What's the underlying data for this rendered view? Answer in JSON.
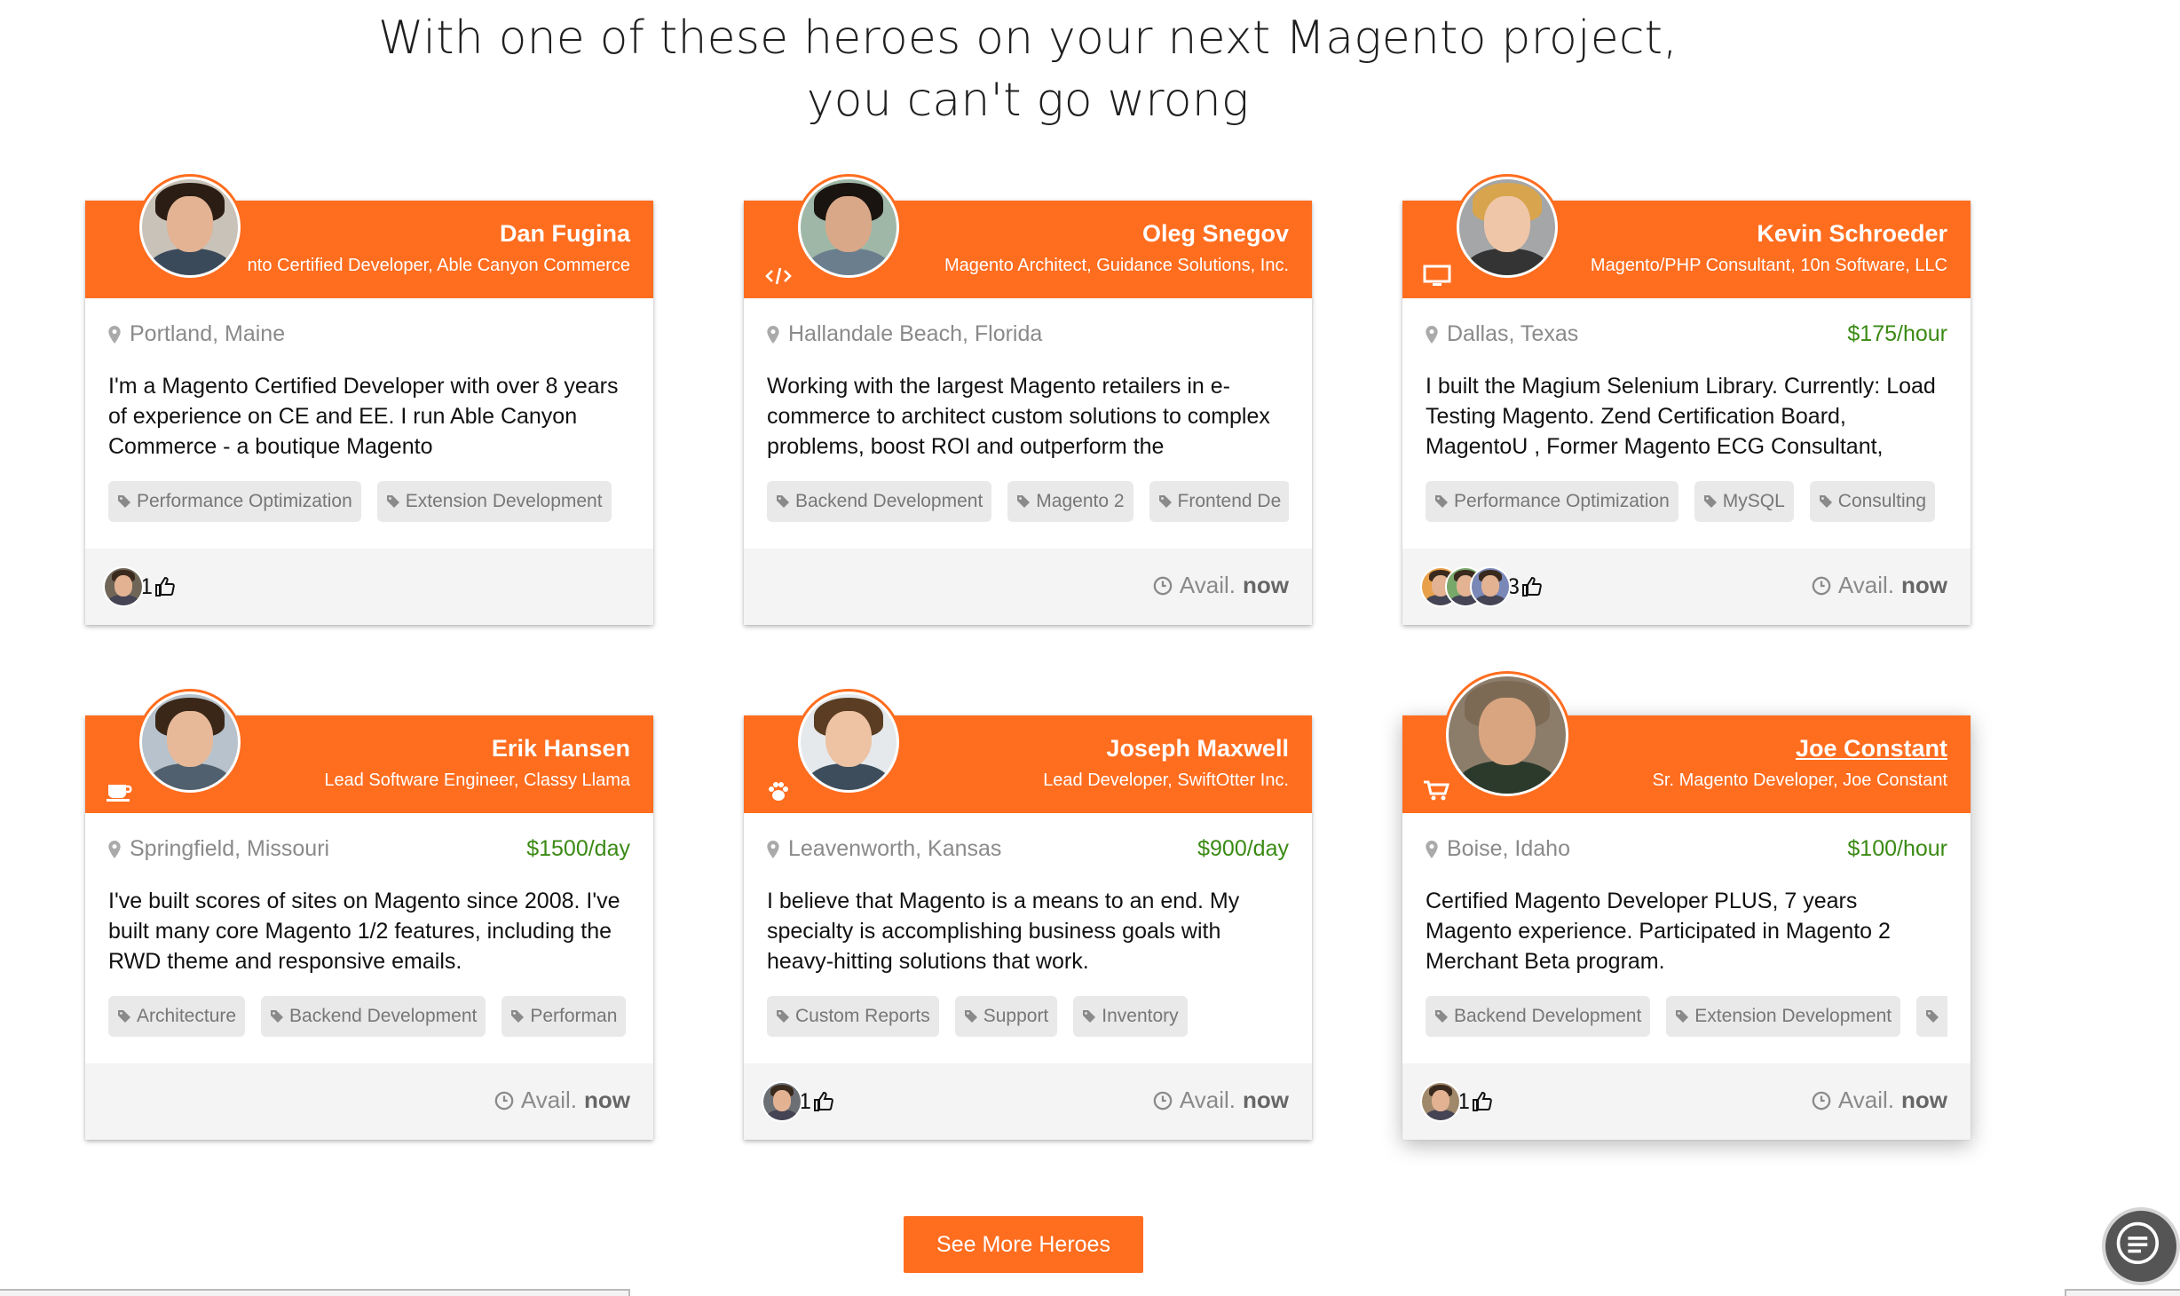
{
  "headline": {
    "line1": "With one of these heroes on your next Magento project,",
    "line2": "you can't go wrong"
  },
  "colors": {
    "accent": "#ff6d1f",
    "rate": "#3a8a14",
    "tag_bg": "#e9e9e9"
  },
  "heroes": [
    {
      "name": "Dan Fugina",
      "title": "nto Certified Developer, Able Canyon Commerce",
      "head_icon": "",
      "location": "Portland, Maine",
      "rate": "",
      "bio": "I'm a Magento Certified Developer with over 8 years of experience on CE and EE. I run Able Canyon Commerce - a boutique Magento",
      "tags": [
        "Performance Optimization",
        "Extension Development"
      ],
      "likes": "1",
      "voter_count": 1,
      "avail_label": "",
      "avail_value": ""
    },
    {
      "name": "Oleg Snegov",
      "title": "Magento Architect, Guidance Solutions, Inc.",
      "head_icon": "code-icon",
      "location": "Hallandale Beach, Florida",
      "rate": "",
      "bio": "Working with the largest Magento retailers in e-commerce to architect custom solutions to complex problems, boost ROI and outperform the",
      "tags": [
        "Backend Development",
        "Magento 2",
        "Frontend De"
      ],
      "likes": "",
      "voter_count": 0,
      "avail_label": "Avail.",
      "avail_value": "now"
    },
    {
      "name": "Kevin Schroeder",
      "title": "Magento/PHP Consultant, 10n Software, LLC",
      "head_icon": "desktop-icon",
      "location": "Dallas, Texas",
      "rate": "$175/hour",
      "bio": "I built the Magium Selenium Library. Currently: Load Testing Magento. Zend Certification Board, MagentoU , Former Magento ECG Consultant,",
      "tags": [
        "Performance Optimization",
        "MySQL",
        "Consulting"
      ],
      "likes": "3",
      "voter_count": 3,
      "avail_label": "Avail.",
      "avail_value": "now"
    },
    {
      "name": "Erik Hansen",
      "title": "Lead Software Engineer, Classy Llama",
      "head_icon": "coffee-icon",
      "location": "Springfield, Missouri",
      "rate": "$1500/day",
      "bio": "I've built scores of sites on Magento since 2008. I've built many core Magento 1/2 features, including the RWD theme and responsive emails.",
      "tags": [
        "Architecture",
        "Backend Development",
        "Performan"
      ],
      "likes": "",
      "voter_count": 0,
      "avail_label": "Avail.",
      "avail_value": "now"
    },
    {
      "name": "Joseph Maxwell",
      "title": "Lead Developer, SwiftOtter Inc.",
      "head_icon": "paw-icon",
      "location": "Leavenworth, Kansas",
      "rate": "$900/day",
      "bio": "I believe that Magento is a means to an end. My specialty is accomplishing business goals with heavy-hitting solutions that work.",
      "tags": [
        "Custom Reports",
        "Support",
        "Inventory"
      ],
      "likes": "1",
      "voter_count": 1,
      "avail_label": "Avail.",
      "avail_value": "now"
    },
    {
      "name": "Joe Constant",
      "title": "Sr. Magento Developer, Joe Constant",
      "head_icon": "cart-icon",
      "location": "Boise, Idaho",
      "rate": "$100/hour",
      "bio": "Certified Magento Developer PLUS, 7 years Magento experience. Participated in Magento 2 Merchant Beta program.",
      "tags": [
        "Backend Development",
        "Extension Development",
        ""
      ],
      "likes": "1",
      "voter_count": 1,
      "avail_label": "Avail.",
      "avail_value": "now"
    }
  ],
  "see_more_label": "See More Heroes"
}
